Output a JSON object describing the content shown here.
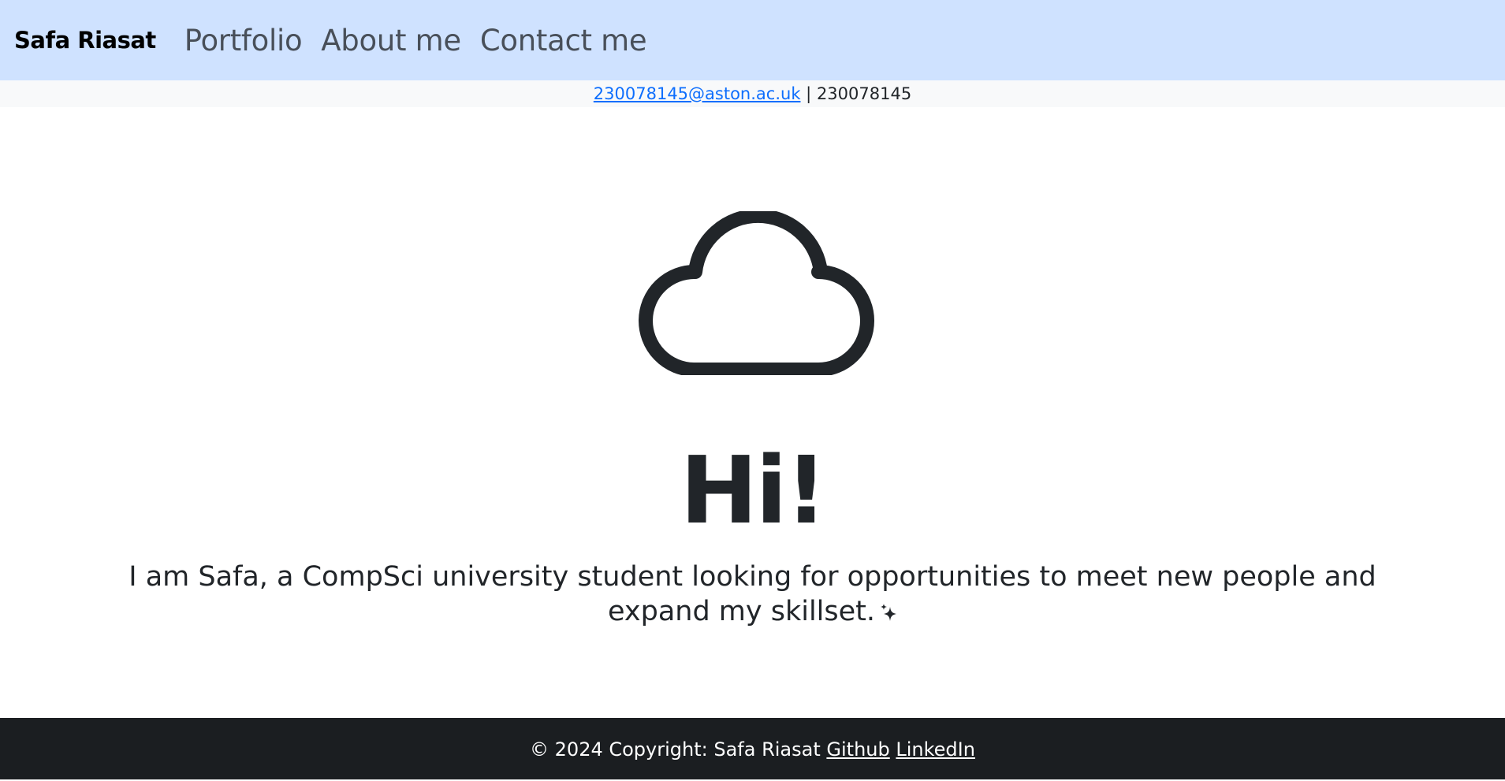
{
  "navbar": {
    "brand": "Safa Riasat",
    "links": [
      "Portfolio",
      "About me",
      "Contact me"
    ],
    "background": "#cfe2ff"
  },
  "contact_bar": {
    "email": "230078145@aston.ac.uk",
    "separator": "|",
    "student_id": "230078145"
  },
  "hero": {
    "icon": "cloud-icon",
    "title": "Hi!",
    "text": "I am Safa, a CompSci university student looking for opportunities to meet new people and expand my skillset.",
    "text_icon": "sparkle-icon"
  },
  "footer": {
    "copyright": "© 2024 Copyright: Safa Riasat",
    "links": [
      "Github",
      "LinkedIn"
    ],
    "background": "#1b1e21"
  },
  "colors": {
    "link": "#0d6efd",
    "text": "#212529"
  }
}
